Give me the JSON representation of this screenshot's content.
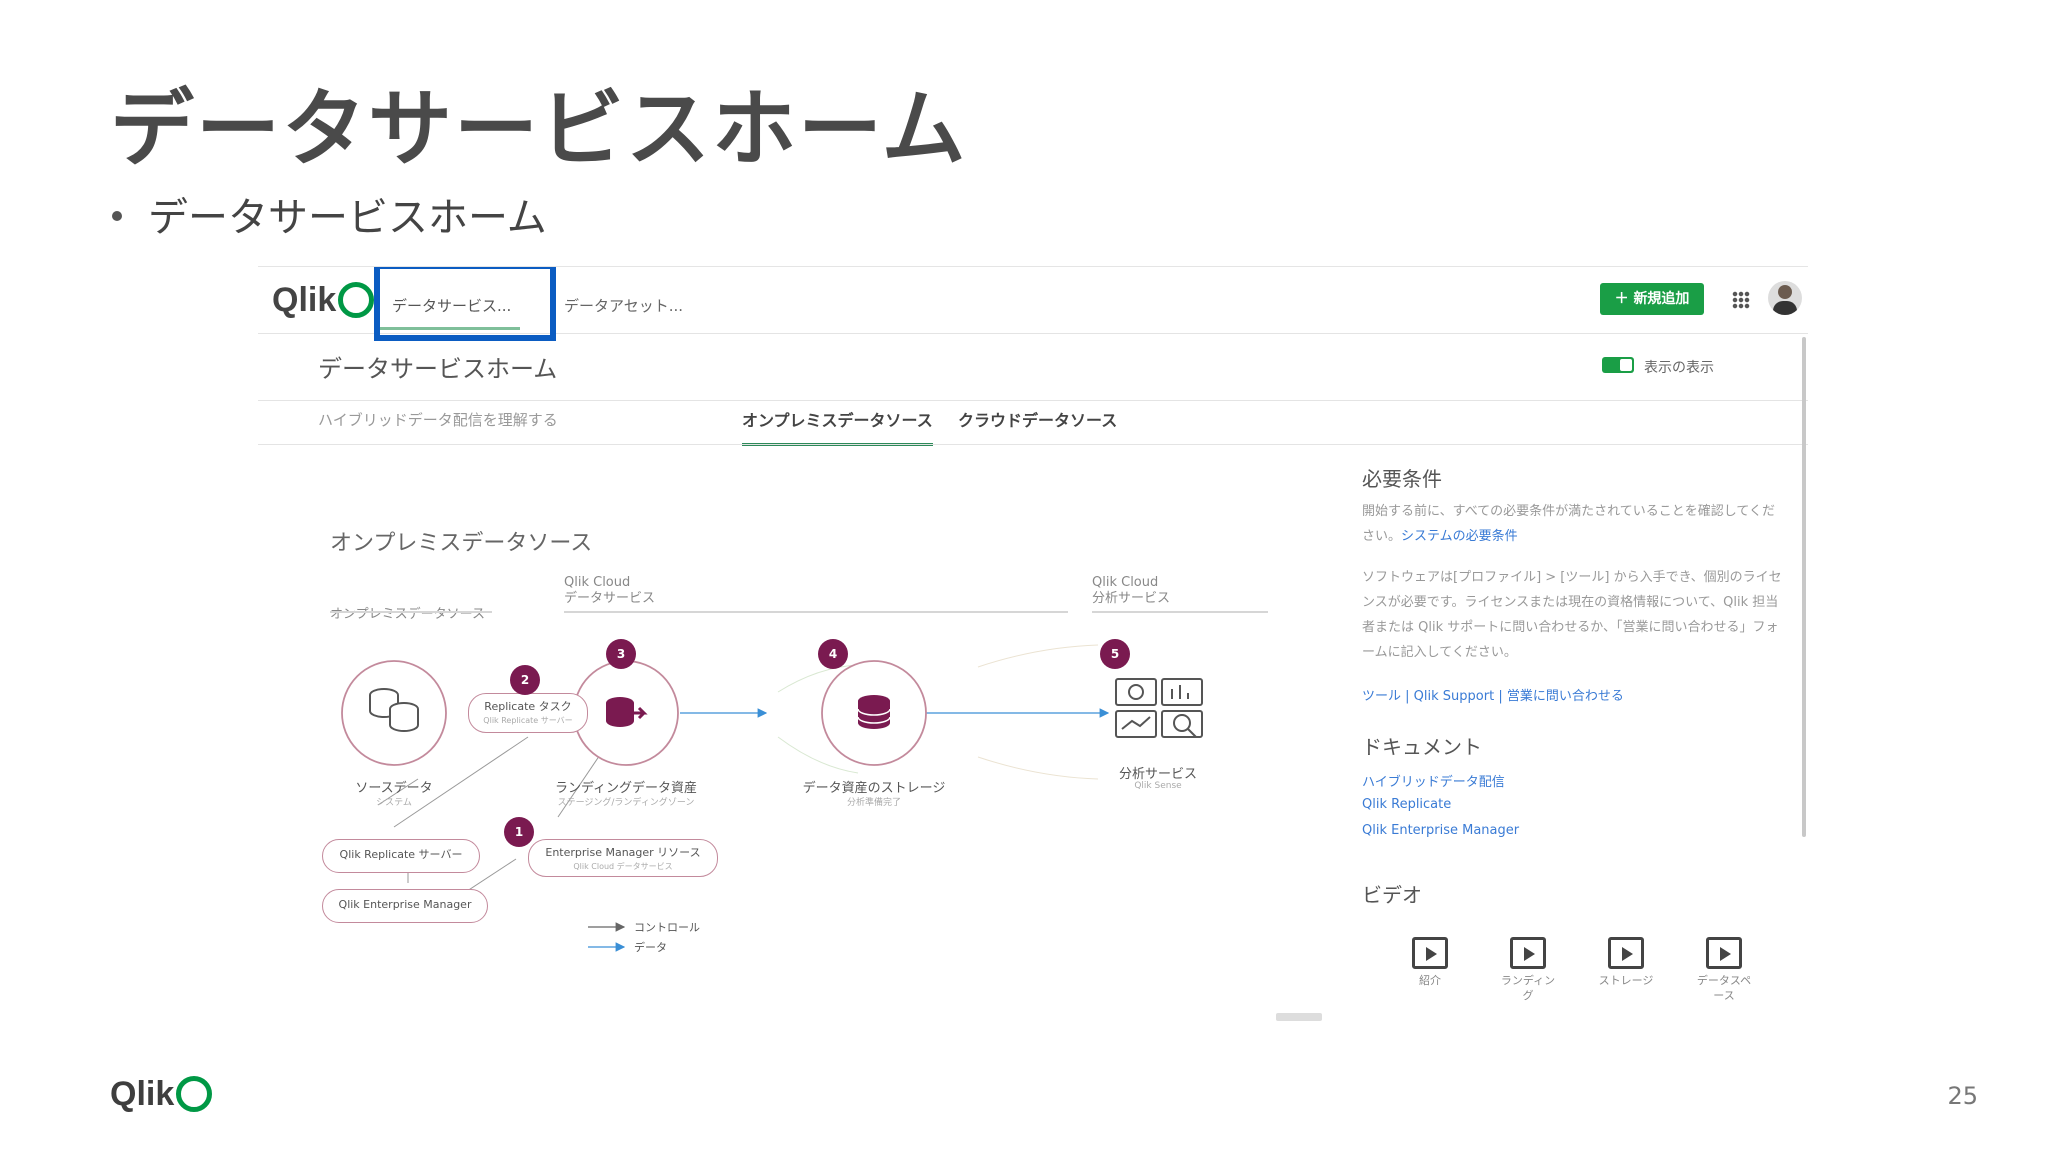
{
  "slide": {
    "title": "データサービスホーム",
    "bullet": "データサービスホーム",
    "page_number": "25",
    "footer_logo": "Qlik"
  },
  "app": {
    "logo": "Qlik",
    "tabs": [
      "データサービス...",
      "データアセット..."
    ],
    "new_button": "新規追加",
    "page_heading": "データサービスホーム",
    "toggle_label": "表示の表示",
    "subnav_left": "ハイブリッドデータ配信を理解する",
    "subtabs": [
      "オンプレミスデータソース",
      "クラウドデータソース"
    ]
  },
  "diagram": {
    "title": "オンプレミスデータソース",
    "columns": [
      {
        "line1": "",
        "line2": "オンプレミスデータソース"
      },
      {
        "line1": "Qlik Cloud",
        "line2": "データサービス"
      },
      {
        "line1": "Qlik Cloud",
        "line2": "分析サービス"
      }
    ],
    "nodes": {
      "source": {
        "label": "ソースデータ",
        "sub": "システム"
      },
      "landing": {
        "label": "ランディングデータ資産",
        "sub": "ステージング/ランディングゾーン"
      },
      "storage": {
        "label": "データ資産のストレージ",
        "sub": "分析準備完了"
      },
      "analytics": {
        "label": "分析サービス",
        "sub": "Qlik Sense"
      }
    },
    "pills": {
      "replicate_task": {
        "label": "Replicate タスク",
        "sub": "Qlik Replicate サーバー"
      },
      "em_resource": {
        "label": "Enterprise Manager リソース",
        "sub": "Qlik Cloud データサービス"
      },
      "replicate_server": {
        "label": "Qlik Replicate サーバー"
      },
      "enterprise_manager": {
        "label": "Qlik Enterprise Manager"
      }
    },
    "badges": [
      "1",
      "2",
      "3",
      "4",
      "5"
    ],
    "legend": [
      "コントロール",
      "データ"
    ],
    "colors": {
      "accent": "#7a1a50",
      "flow": "#3a8fd6",
      "node": "#c38a9c"
    }
  },
  "panel": {
    "prereq_title": "必要条件",
    "prereq_text1": "開始する前に、すべての必要条件が満たされていることを確認してください。",
    "prereq_link": "システムの必要条件",
    "prereq_text2": "ソフトウェアは[プロファイル] > [ツール] から入手でき、個別のライセンスが必要です。ライセンスまたは現在の資格情報について、Qlik 担当者または Qlik サポートに問い合わせるか、「営業に問い合わせる」フォームに記入してください。",
    "links_row": [
      "ツール",
      "Qlik Support",
      "営業に問い合わせる"
    ],
    "docs_title": "ドキュメント",
    "docs": [
      "ハイブリッドデータ配信",
      "Qlik Replicate",
      "Qlik Enterprise Manager"
    ],
    "video_title": "ビデオ",
    "videos": [
      "紹介",
      "ランディング",
      "ストレージ",
      "データスペース"
    ]
  }
}
